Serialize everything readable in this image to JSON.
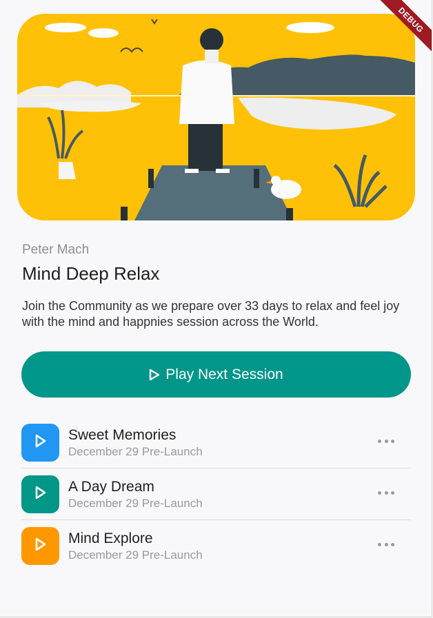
{
  "debug_label": "DEBUG",
  "session": {
    "author": "Peter Mach",
    "title": "Mind Deep Relax",
    "description": "Join the Community as we prepare over 33 days to relax and feel joy with the mind and happnies session across the World."
  },
  "play_button": {
    "label": "Play Next Session",
    "icon": "play-outline-icon"
  },
  "tracks": [
    {
      "title": "Sweet Memories",
      "subtitle": "December 29 Pre-Launch",
      "color": "#2196f3",
      "icon": "play-icon"
    },
    {
      "title": "A Day Dream",
      "subtitle": "December 29 Pre-Launch",
      "color": "#009688",
      "icon": "play-icon"
    },
    {
      "title": "Mind Explore",
      "subtitle": "December 29 Pre-Launch",
      "color": "#ff9800",
      "icon": "play-icon"
    }
  ],
  "colors": {
    "accent": "#00968a",
    "hero_bg": "#ffc107",
    "debug_ribbon": "#9e1b23"
  }
}
